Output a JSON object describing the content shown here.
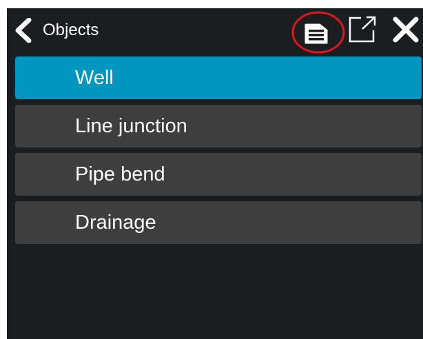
{
  "header": {
    "title": "Objects",
    "back_icon": "chevron-left-icon",
    "actions": [
      {
        "name": "list-view",
        "icon": "list-document-icon",
        "highlighted": true
      },
      {
        "name": "open-external",
        "icon": "external-link-icon"
      },
      {
        "name": "close",
        "icon": "close-icon"
      }
    ]
  },
  "objects": {
    "items": [
      {
        "label": "Well",
        "selected": true
      },
      {
        "label": "Line junction",
        "selected": false
      },
      {
        "label": "Pipe bend",
        "selected": false
      },
      {
        "label": "Drainage",
        "selected": false
      }
    ]
  },
  "colors": {
    "panel_background": "#1b1e21",
    "item_background": "#3e3e3e",
    "selected_background": "#0096c0",
    "highlight_ring": "#e3141c",
    "text": "#ffffff"
  }
}
